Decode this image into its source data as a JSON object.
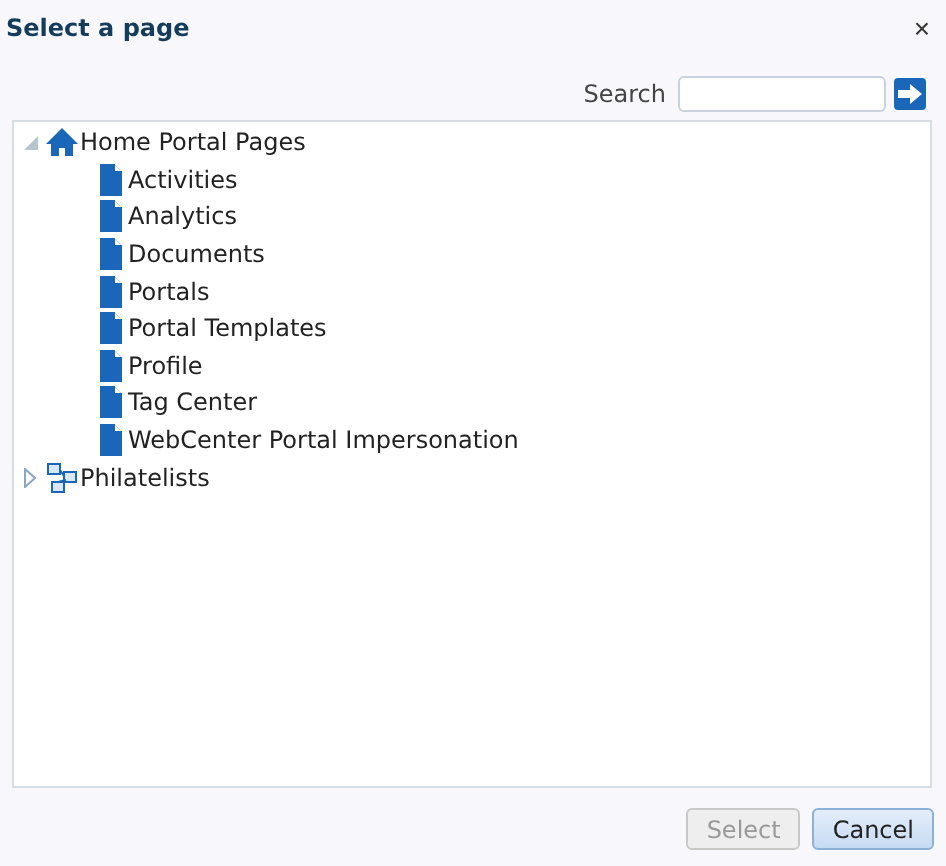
{
  "dialog": {
    "title": "Select a page",
    "close": "×"
  },
  "search": {
    "label": "Search"
  },
  "tree": [
    {
      "label": "Home Portal Pages",
      "kind": "home",
      "expanded": true,
      "children": [
        {
          "label": "Activities",
          "kind": "page"
        },
        {
          "label": "Analytics",
          "kind": "page"
        },
        {
          "label": "Documents",
          "kind": "page"
        },
        {
          "label": "Portals",
          "kind": "page"
        },
        {
          "label": "Portal Templates",
          "kind": "page"
        },
        {
          "label": "Profile",
          "kind": "page"
        },
        {
          "label": "Tag Center",
          "kind": "page"
        },
        {
          "label": "WebCenter Portal Impersonation",
          "kind": "page"
        }
      ]
    },
    {
      "label": "Philatelists",
      "kind": "group",
      "expanded": false
    }
  ],
  "buttons": [
    {
      "label": "Select",
      "disabled": true
    },
    {
      "label": "Cancel",
      "disabled": false
    }
  ]
}
